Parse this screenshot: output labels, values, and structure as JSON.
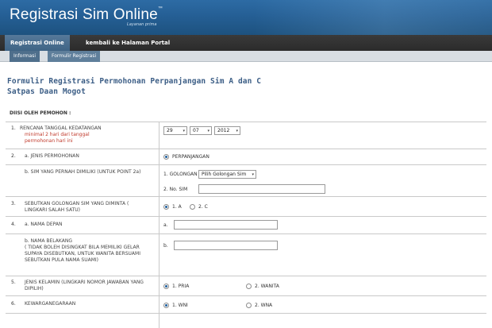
{
  "header": {
    "title": "Registrasi Sim Online",
    "title_mark": "™",
    "subtitle": "Layanan prima"
  },
  "nav": {
    "primary": [
      "Registrasi Online",
      "kembali ke Halaman Portal"
    ],
    "secondary": [
      "Informasi",
      "Formulir Registrasi"
    ]
  },
  "form": {
    "title_line1": "Formulir Registrasi Permohonan Perpanjangan Sim A dan C",
    "title_line2": "Satpas Daan Mogot",
    "section_header": "DIISI OLEH PEMOHON :",
    "rows": {
      "r1": {
        "num": "1.",
        "label": "RENCANA TANGGAL KEDATANGAN",
        "note": "minimal 2 hari dari tanggal permohonan hari ini",
        "day": "29",
        "month": "07",
        "year": "2012"
      },
      "r2a": {
        "num": "2.",
        "label": "a. JENIS PERMOHONAN",
        "option": "PERPANJANGAN"
      },
      "r2b": {
        "label": "b. SIM YANG PERNAH DIMILIKI (UNTUK POINT 2a)",
        "golongan_label": "1. GOLONGAN",
        "golongan_select": "Pilih Golongan Sim",
        "nosim_label": "2. No. SIM"
      },
      "r3": {
        "num": "3.",
        "label": "SEBUTKAN GOLONGAN SIM YANG DIMINTA ( LINGKARI SALAH SATU)",
        "opt1": "1. A",
        "opt2": "2. C"
      },
      "r4a": {
        "num": "4.",
        "label": "a. NAMA DEPAN",
        "field_label": "a."
      },
      "r4b": {
        "label": "b. NAMA BELAKANG",
        "hint": "( TIDAK BOLEH DISINGKAT BILA MEMILIKI GELAR SUPAYA DISEBUTKAN, UNTUK WANITA BERSUAMI SEBUTKAN PULA NAMA SUAMI)",
        "field_label": "b."
      },
      "r5": {
        "num": "5.",
        "label": "JENIS KELAMIN (LINGKARI NOMOR JAWABAN YANG DIPILIH)",
        "opt1": "1. PRIA",
        "opt2": "2. WANITA"
      },
      "r6": {
        "num": "6.",
        "label": "KEWARGANEGARAAN",
        "opt1": "1. WNI",
        "opt2": "2. WNA"
      }
    }
  },
  "colors": {
    "banner": "#255f95",
    "nav_bg": "#2b2b2b",
    "title": "#3c5e86",
    "note": "#c0392b",
    "radio_dot": "#1f5f9e"
  }
}
